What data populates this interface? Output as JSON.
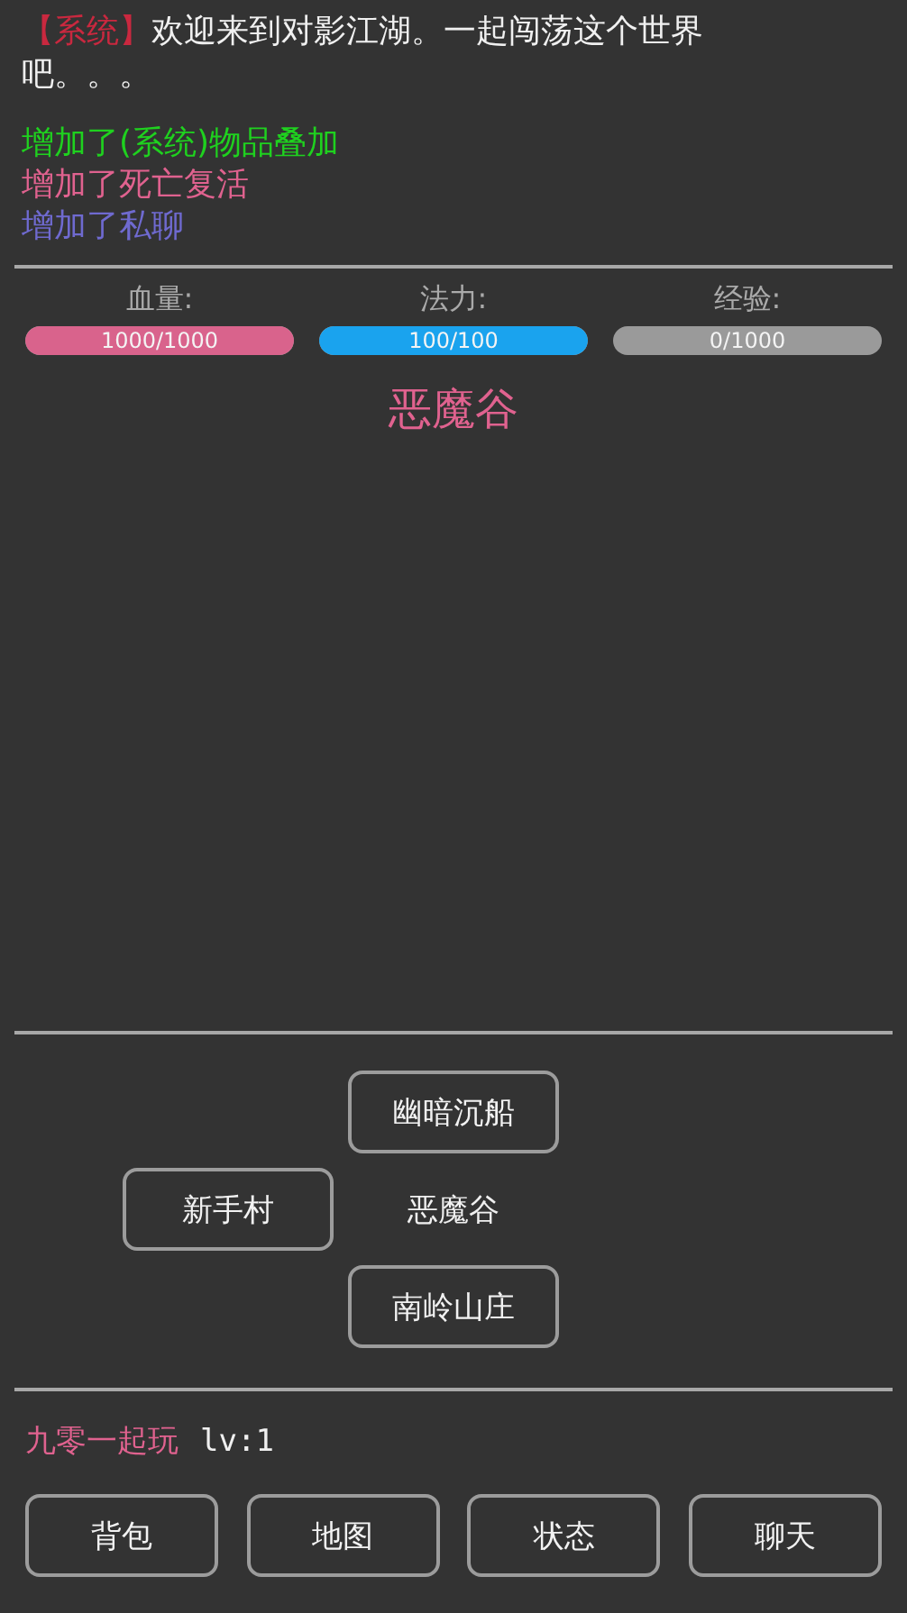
{
  "system_message": {
    "tag": "【系统】",
    "text": "欢迎来到对影江湖。一起闯荡这个世界吧。。。"
  },
  "log": [
    {
      "text": "增加了(系统)物品叠加",
      "color": "#1fd11f"
    },
    {
      "text": "增加了死亡复活",
      "color": "#e0628f"
    },
    {
      "text": "增加了私聊",
      "color": "#6f6ad0"
    }
  ],
  "stats": [
    {
      "label": "血量:",
      "reading": "1000/1000",
      "level": 1,
      "color": "#d9638c"
    },
    {
      "label": "法力:",
      "reading": "100/100",
      "level": 1,
      "color": "#1aa3ee"
    },
    {
      "label": "经验:",
      "reading": "0/1000"
    }
  ],
  "location": "恶魔谷",
  "map": {
    "north": {
      "kind": "exit",
      "label": "幽暗沉船"
    },
    "west": {
      "kind": "exit",
      "label": "新手村"
    },
    "center": {
      "kind": "here",
      "label": "恶魔谷"
    },
    "south": {
      "kind": "exit",
      "label": "南岭山庄"
    }
  },
  "player": {
    "name": "九零一起玩",
    "level": "lv:1"
  },
  "menu": [
    "背包",
    "地图",
    "状态",
    "聊天"
  ]
}
